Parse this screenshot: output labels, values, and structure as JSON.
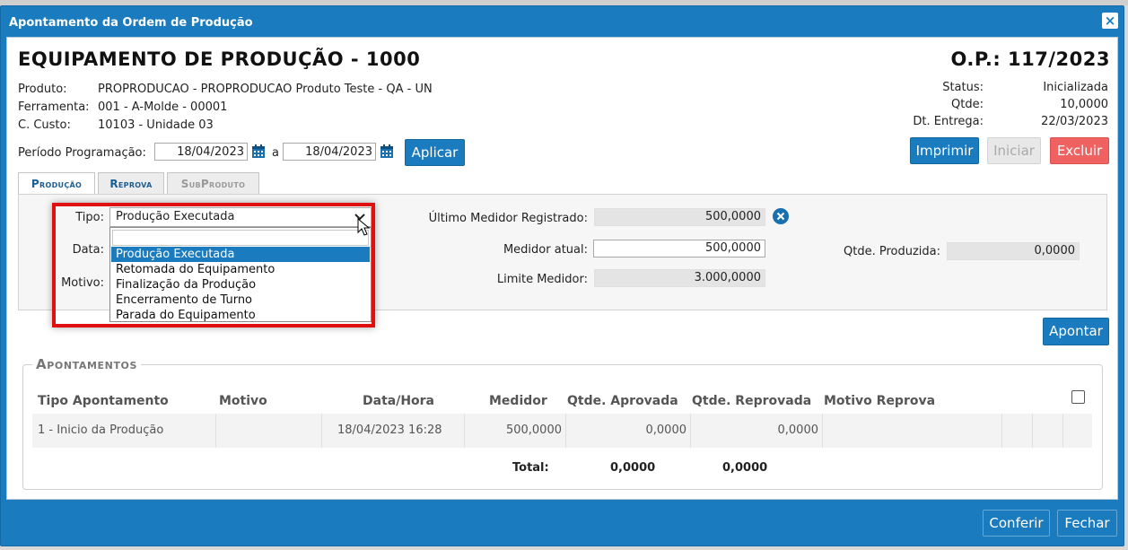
{
  "dialog": {
    "title": "Apontamento da Ordem de Produção",
    "close_symbol": "×"
  },
  "header": {
    "equipment_title": "EQUIPAMENTO DE PRODUÇÃO - 1000",
    "op_title": "O.P.: 117/2023",
    "info": [
      {
        "label": "Produto:",
        "value": "PROPRODUCAO - PROPRODUCAO Produto Teste - QA - UN"
      },
      {
        "label": "Ferramenta:",
        "value": "001 - A-Molde - 00001"
      },
      {
        "label": "C. Custo:",
        "value": "10103 - Unidade 03"
      }
    ],
    "status": [
      {
        "label": "Status:",
        "value": "Inicializada"
      },
      {
        "label": "Qtde:",
        "value": "10,0000"
      },
      {
        "label": "Dt. Entrega:",
        "value": "22/03/2023"
      }
    ]
  },
  "period": {
    "label": "Período Programação:",
    "start": "18/04/2023",
    "separator": "a",
    "end": "18/04/2023",
    "apply_label": "Aplicar"
  },
  "actions": {
    "print_label": "Imprimir",
    "start_label": "Iniciar",
    "delete_label": "Excluir"
  },
  "tabs": [
    {
      "label": "Produção",
      "state": "active"
    },
    {
      "label": "Reprova",
      "state": "normal"
    },
    {
      "label": "SubProduto",
      "state": "disabled"
    }
  ],
  "form": {
    "tipo_label": "Tipo:",
    "tipo_value": "Produção Executada",
    "data_label": "Data:",
    "motivo_label": "Motivo:",
    "tipo_options": [
      "Produção Executada",
      "Retomada do Equipamento",
      "Finalização da Produção",
      "Encerramento de Turno",
      "Parada do Equipamento"
    ],
    "ultimo_medidor_label": "Último Medidor Registrado:",
    "ultimo_medidor_value": "500,0000",
    "medidor_atual_label": "Medidor atual:",
    "medidor_atual_value": "500,0000",
    "limite_medidor_label": "Limite Medidor:",
    "limite_medidor_value": "3.000,0000",
    "qtde_produzida_label": "Qtde. Produzida:",
    "qtde_produzida_value": "0,0000",
    "apontar_label": "Apontar"
  },
  "apontamentos": {
    "legend": "Apontamentos",
    "columns": [
      "Tipo Apontamento",
      "Motivo",
      "Data/Hora",
      "Medidor",
      "Qtde. Aprovada",
      "Qtde. Reprovada",
      "Motivo Reprova"
    ],
    "rows": [
      {
        "tipo": "1 - Inicio da Produção",
        "motivo": "",
        "datahora": "18/04/2023 16:28",
        "medidor": "500,0000",
        "aprovada": "0,0000",
        "reprovada": "0,0000",
        "motivo_reprova": ""
      }
    ],
    "total_label": "Total:",
    "total_aprovada": "0,0000",
    "total_reprovada": "0,0000"
  },
  "footer": {
    "conferir_label": "Conferir",
    "fechar_label": "Fechar"
  },
  "colors": {
    "primary": "#1a7bbf",
    "danger": "#f06262",
    "highlight_frame": "#e01010"
  }
}
